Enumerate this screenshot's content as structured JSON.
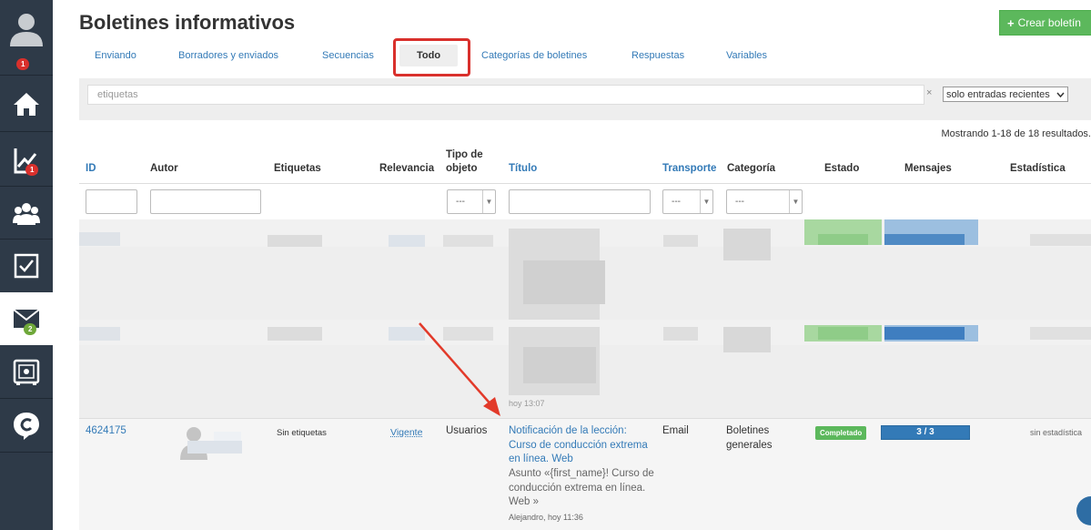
{
  "app": {
    "title": "Boletines informativos",
    "create_button": "Crear boletín"
  },
  "sidebar": {
    "profile_badge": "1",
    "stats_badge": "1",
    "mail_badge": "2"
  },
  "tabs": [
    {
      "label": "Enviando"
    },
    {
      "label": "Borradores y enviados"
    },
    {
      "label": "Secuencias"
    },
    {
      "label": "Todo"
    },
    {
      "label": "Categorías de boletines"
    },
    {
      "label": "Respuestas"
    },
    {
      "label": "Variables"
    }
  ],
  "filter": {
    "placeholder": "etiquetas",
    "clear": "×",
    "select_value": "solo entradas recientes"
  },
  "results_text": "Mostrando 1-18 de 18 resultados.",
  "table": {
    "headers": {
      "id": "ID",
      "author": "Autor",
      "tags": "Etiquetas",
      "relevance": "Relevancia",
      "object_type_1": "Tipo de",
      "object_type_2": "objeto",
      "title": "Título",
      "transport": "Transporte",
      "category": "Categoría",
      "status": "Estado",
      "messages": "Mensajes",
      "stats": "Estadística"
    },
    "select_placeholder": "---",
    "partial_time": "hoy 13:07",
    "row": {
      "id": "4624175",
      "tags": "Sin etiquetas",
      "relevance": "Vigente",
      "object_type": "Usuarios",
      "title_1": "Notificación de la lección:",
      "title_2": "Curso de conducción extrema",
      "title_3": "en línea. Web",
      "subject_1": "Asunto «{first_name}! Curso de",
      "subject_2": "conducción extrema en línea.",
      "subject_3": "Web »",
      "meta": "Alejandro, hoy 11:36",
      "transport": "Email",
      "category_1": "Boletines",
      "category_2": "generales",
      "status": "Completado",
      "messages": "3 / 3",
      "stats": "sin estadística"
    }
  },
  "colors": {
    "sidebar": "#2e3a48",
    "link": "#337ab7",
    "success": "#5cb85c",
    "danger": "#d9302c"
  }
}
